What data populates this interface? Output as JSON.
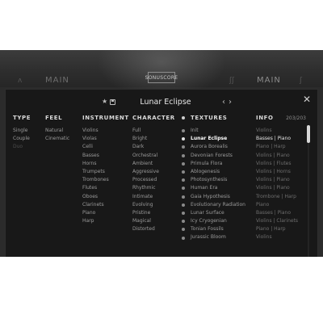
{
  "brand": "SONUSCORE",
  "background": {
    "tab_left": "MAIN",
    "tab_right": "MAIN"
  },
  "preset": {
    "name": "Lunar Eclipse"
  },
  "headers": {
    "type": "TYPE",
    "feel": "FEEL",
    "instrument": "INSTRUMENT",
    "character": "CHARACTER",
    "textures": "TEXTURES",
    "info": "INFO"
  },
  "counter": "203/203",
  "type": [
    "Single",
    "Couple",
    "Duo"
  ],
  "feel": [
    "Natural",
    "Cinematic"
  ],
  "instrument": [
    "Violins",
    "Violas",
    "Celli",
    "Basses",
    "Horns",
    "Trumpets",
    "Trombones",
    "Flutes",
    "Oboes",
    "Clarinets",
    "Piano",
    "Harp"
  ],
  "character": [
    "Full",
    "Bright",
    "Dark",
    "Orchestral",
    "Ambient",
    "Aggressive",
    "Processed",
    "Rhythmic",
    "Intimate",
    "Evolving",
    "Pristine",
    "Magical",
    "Distorted"
  ],
  "textures": [
    "Init",
    "Lunar Eclipse",
    "Aurora Borealis",
    "Devonian Forests",
    "Primula Flora",
    "Ablogenesis",
    "Photosynthesis",
    "Human Era",
    "Gaia Hypothesis",
    "Evolutionary Radiation",
    "Lunar Surface",
    "Icy Cryogenian",
    "Tonian Fossils",
    "Jurassic Bloom"
  ],
  "info": [
    "Violins",
    "Basses | Piano",
    "Piano | Harp",
    "Violins | Piano",
    "Violins | Flutes",
    "Violins | Horns",
    "Violins | Piano",
    "Violins | Piano",
    "Trombone | Harp",
    "Piano",
    "Basses | Piano",
    "Violins | Clarinets",
    "Piano | Harp",
    "Violins"
  ],
  "icons": {
    "favorite": "star-icon",
    "save": "save-icon",
    "prev": "chevron-left-icon",
    "next": "chevron-right-icon",
    "close": "close-icon",
    "refresh": "refresh-icon",
    "edit": "edit-icon",
    "delete": "trash-icon",
    "more": "more-icon"
  },
  "colors": {
    "panel": "#181818",
    "frame": "#2b2b2b",
    "text_active": "#ffffff",
    "text_normal": "#9b9b9b"
  }
}
